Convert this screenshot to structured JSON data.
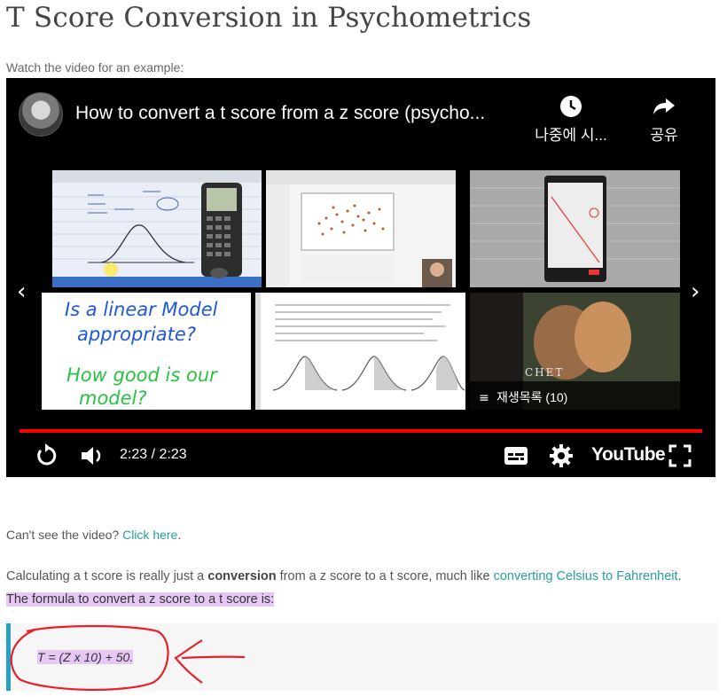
{
  "page": {
    "title": "T Score Conversion in Psychometrics",
    "watch_text": "Watch the video for an example:"
  },
  "video": {
    "title": "How to convert a t score from a z score (psycho...",
    "watch_later_label": "나중에 시...",
    "share_label": "공유",
    "playlist_label": "재생목록 (10)",
    "time": "2:23 / 2:23",
    "logo_text": "YouTube",
    "progress": 1.0,
    "progress_color": "#ff0000",
    "thumbnails": [
      {
        "name": "thumb-ti84-calculator"
      },
      {
        "name": "thumb-scatter-plot"
      },
      {
        "name": "thumb-phone-screen"
      },
      {
        "name": "thumb-linear-model",
        "lines": [
          "Is a linear Model",
          "appropriate?",
          "How good is our",
          "model?"
        ]
      },
      {
        "name": "thumb-normal-curves"
      },
      {
        "name": "thumb-chet-album",
        "caption": "CHET"
      }
    ]
  },
  "body": {
    "cant_see_prefix": "Can't see the video? ",
    "click_here": "Click here",
    "cant_see_suffix": ".",
    "para_prefix": "Calculating a t score is really just a ",
    "para_bold": "conversion",
    "para_mid": " from a z score to a t score, much like ",
    "para_link": "converting Celsius to Fahrenheit",
    "para_dot": ". ",
    "para_highlight": "The formula to convert a z score to a t score is:",
    "formula": "T = (Z x 10) + 50."
  },
  "colors": {
    "link": "#2a9d9d",
    "highlight": "#e7c7f4",
    "quote_border": "#26a0c3",
    "annotation": "#e8202a"
  }
}
